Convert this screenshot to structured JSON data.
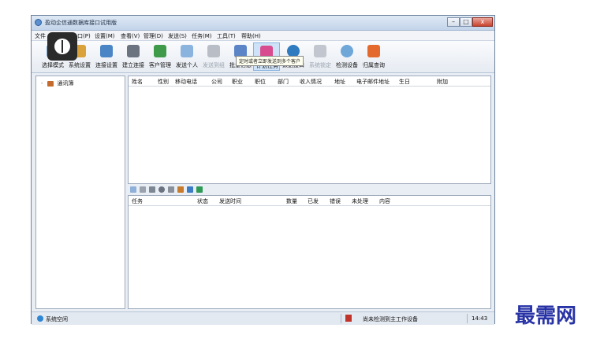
{
  "window": {
    "title": "盈动企信通数据库接口试用版",
    "controls": {
      "minimize": "–",
      "maximize": "□",
      "close": "x"
    }
  },
  "menu": [
    "文件",
    "口(P)",
    "设置(M)",
    "查看(V)",
    "管理(D)",
    "发送(S)",
    "任务(M)",
    "工具(T)",
    "帮助(H)"
  ],
  "toolbar": {
    "items": [
      {
        "label": "选择模式"
      },
      {
        "label": "系统设置"
      },
      {
        "label": "连接设置"
      },
      {
        "label": "建立连接"
      },
      {
        "label": "客户管理"
      },
      {
        "label": "发送个人"
      },
      {
        "label": "发送到组"
      },
      {
        "label": "批量信息"
      },
      {
        "label": "计划任务"
      },
      {
        "label": "数据接口"
      },
      {
        "label": "系统锁定"
      },
      {
        "label": "检测设备"
      },
      {
        "label": "归属查询"
      }
    ],
    "tooltip": "定时或者立即发送到多个客户"
  },
  "tree": {
    "root": "通讯簿"
  },
  "contacts_table": {
    "columns": [
      "姓名",
      "性别",
      "移动电话",
      "公司",
      "职业",
      "职位",
      "部门",
      "收入情况",
      "地址",
      "电子邮件地址",
      "生日",
      "附加"
    ]
  },
  "tasks_table": {
    "columns": [
      "任务",
      "状态",
      "发送时间",
      "数量",
      "已发",
      "错误",
      "未处理",
      "内容"
    ]
  },
  "status": {
    "left": "系统空闲",
    "device": "尚未检测到主工作设备",
    "time": "14:43"
  },
  "watermark": "最需网"
}
